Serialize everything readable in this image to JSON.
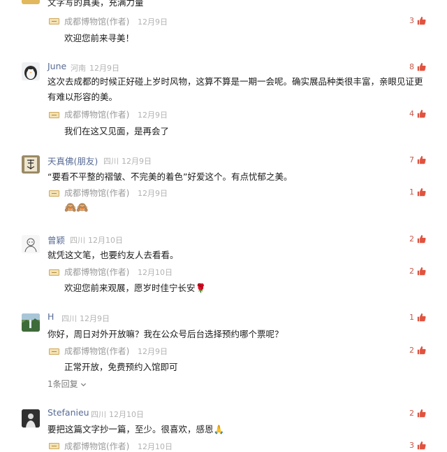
{
  "comments": [
    {
      "user": "",
      "region": "",
      "date": "",
      "text": "文字写的真美，充满力量",
      "likes": "",
      "replies": [
        {
          "author": "成都博物馆(作者)",
          "date": "12月9日",
          "text": "欢迎您前来寻美！",
          "likes": "3"
        }
      ]
    },
    {
      "user": "June",
      "region": "河南",
      "date": "12月9日",
      "text": "这次去成都的时候正好碰上岁时风物，这算不算是一期一会呢。确实展品种类很丰富，亲眼见证更有难以形容的美。",
      "likes": "8",
      "replies": [
        {
          "author": "成都博物馆(作者)",
          "date": "12月9日",
          "text": "我们在这又见面，是再会了",
          "likes": "4"
        }
      ]
    },
    {
      "user": "天真佛(朋友)",
      "region": "四川",
      "date": "12月9日",
      "text": "“要看不平整的褶皱、不完美的着色”好爱这个。有点忧郁之美。",
      "likes": "7",
      "replies": [
        {
          "author": "成都博物馆(作者)",
          "date": "12月9日",
          "text": "🙈🙈",
          "likes": "1"
        }
      ]
    },
    {
      "user": "曾颖",
      "region": "四川",
      "date": "12月10日",
      "text": "就凭这文笔，也要约友人去看看。",
      "likes": "2",
      "replies": [
        {
          "author": "成都博物馆(作者)",
          "date": "12月10日",
          "text": "欢迎您前来观展，愿岁时佳宁长安🌹",
          "likes": "2"
        }
      ]
    },
    {
      "user": "H",
      "region": "四川",
      "date": "12月9日",
      "text": "你好，周日对外开放嘛？我在公众号后台选择预约哪个票呢？",
      "likes": "1",
      "replies": [
        {
          "author": "成都博物馆(作者)",
          "date": "12月9日",
          "text": "正常开放，免费预约入馆即可",
          "likes": "2"
        }
      ],
      "more_replies": "1条回复"
    },
    {
      "user": "Stefanieu",
      "region": "四川",
      "date": "12月10日",
      "text": "要把这篇文字抄一篇，至少。很喜欢，感恩🙏",
      "likes": "2",
      "replies": [
        {
          "author": "成都博物馆(作者)",
          "date": "12月10日",
          "text": "",
          "likes": "3"
        }
      ]
    }
  ],
  "icons": {
    "like": "thumbs-up-icon",
    "logo": "museum-logo-icon",
    "chevron": "chevron-down-icon"
  },
  "colors": {
    "like": "#e0533f",
    "link": "#576b95",
    "meta": "#b2b2b2"
  }
}
